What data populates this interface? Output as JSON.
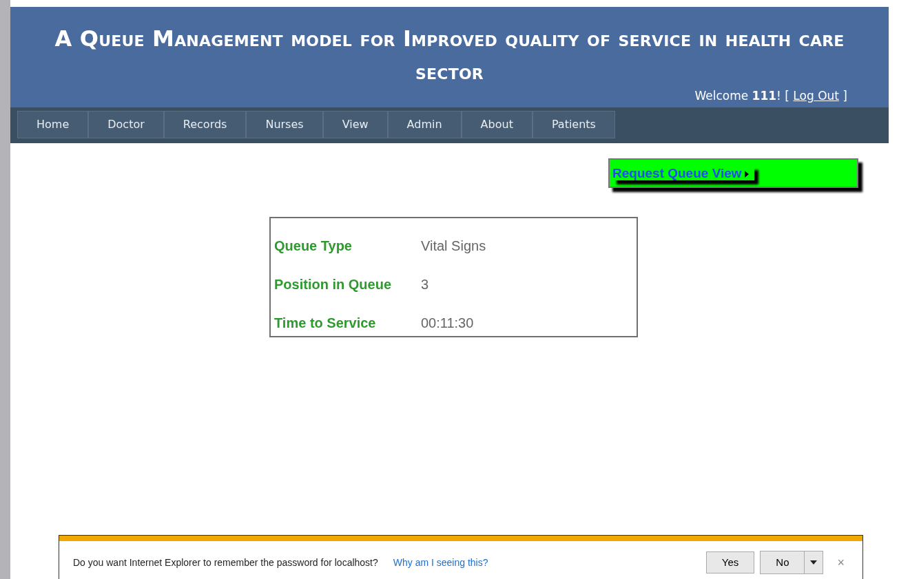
{
  "header": {
    "title": "A Queue Management model for Improved quality of service in health care sector",
    "welcome_prefix": "Welcome ",
    "user": "111",
    "welcome_suffix": "! [ ",
    "logout": "Log Out",
    "welcome_end": " ]"
  },
  "menu": [
    {
      "label": "Home"
    },
    {
      "label": "Doctor"
    },
    {
      "label": "Records"
    },
    {
      "label": "Nurses"
    },
    {
      "label": "View"
    },
    {
      "label": "Admin"
    },
    {
      "label": "About"
    },
    {
      "label": "Patients"
    }
  ],
  "request_link": "Request Queue View",
  "queue_info": [
    {
      "label": "Queue Type",
      "value": "Vital Signs"
    },
    {
      "label": "Position in Queue",
      "value": "3"
    },
    {
      "label": "Time to Service",
      "value": "00:11:30"
    }
  ],
  "notification_bar": {
    "message": "Do you want Internet Explorer to remember the password for localhost?",
    "help_link": "Why am I seeing this?",
    "buttons": [
      "Yes",
      "No"
    ],
    "close": "×"
  }
}
